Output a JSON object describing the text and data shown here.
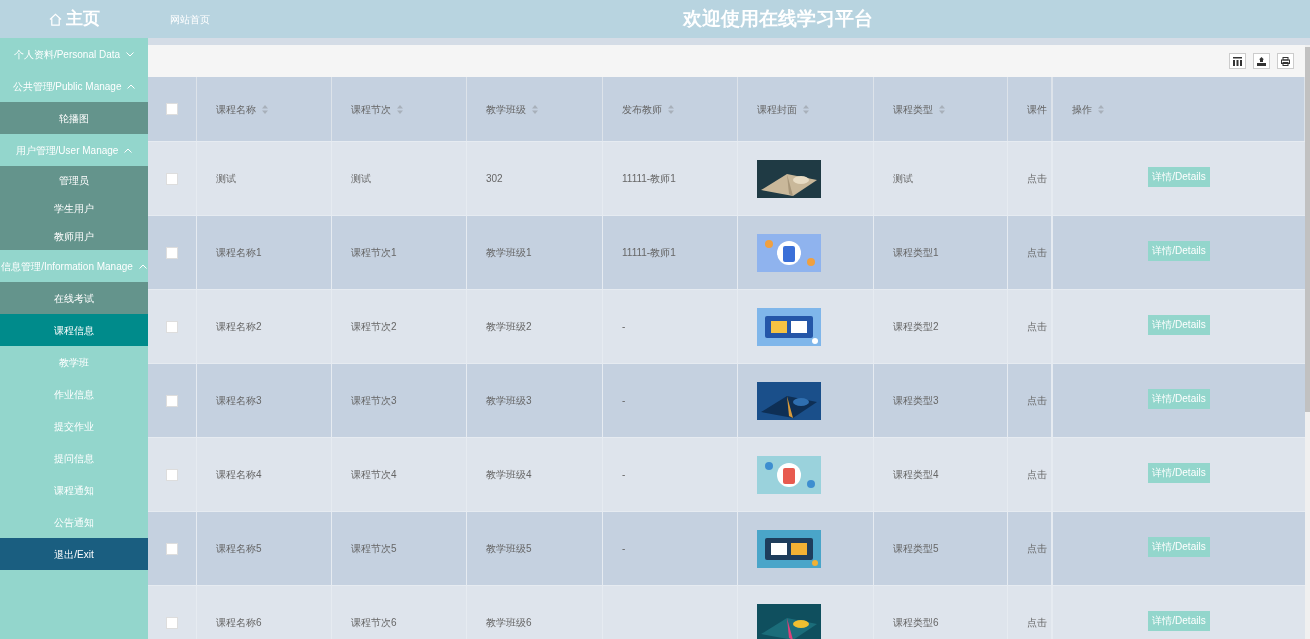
{
  "header": {
    "brand": "主页",
    "home_link": "网站首页",
    "title": "欢迎使用在线学习平台"
  },
  "sidebar": [
    {
      "label": "个人资料/Personal Data",
      "expanded": false
    },
    {
      "label": "公共管理/Public Manage",
      "expanded": true,
      "children": [
        {
          "label": "轮播图",
          "selected": false,
          "shaded": true
        }
      ]
    },
    {
      "label": "用户管理/User Manage",
      "expanded": true,
      "children": [
        {
          "label": "管理员",
          "selected": false,
          "shaded": true
        },
        {
          "label": "学生用户",
          "selected": false,
          "shaded": true
        },
        {
          "label": "教师用户",
          "selected": false,
          "shaded": true
        }
      ]
    },
    {
      "label": "信息管理/Information Manage",
      "expanded": true,
      "children": [
        {
          "label": "在线考试",
          "selected": false,
          "shaded": true
        },
        {
          "label": "课程信息",
          "selected": true,
          "shaded": true
        },
        {
          "label": "教学班",
          "selected": false,
          "shaded": false
        },
        {
          "label": "作业信息",
          "selected": false,
          "shaded": false
        },
        {
          "label": "提交作业",
          "selected": false,
          "shaded": false
        },
        {
          "label": "提问信息",
          "selected": false,
          "shaded": false
        },
        {
          "label": "课程通知",
          "selected": false,
          "shaded": false
        },
        {
          "label": "公告通知",
          "selected": false,
          "shaded": false
        }
      ]
    }
  ],
  "exit": "退出/Exit",
  "table": {
    "all_checked": false,
    "columns": [
      {
        "label": "课程名称",
        "sortable": true
      },
      {
        "label": "课程节次",
        "sortable": true
      },
      {
        "label": "教学班级",
        "sortable": true
      },
      {
        "label": "发布教师",
        "sortable": true
      },
      {
        "label": "课程封面",
        "sortable": true
      },
      {
        "label": "课程类型",
        "sortable": true
      },
      {
        "label": "课件",
        "sortable": false
      },
      {
        "label": "操作",
        "sortable": true
      }
    ],
    "rows": [
      {
        "checked": false,
        "name": "测试",
        "section": "测试",
        "class": "302",
        "teacher": "11111-教师1",
        "type": "测试",
        "courseware": "点击",
        "action": "详情/Details"
      },
      {
        "checked": false,
        "name": "课程名称1",
        "section": "课程节次1",
        "class": "教学班级1",
        "teacher": "11111-教师1",
        "type": "课程类型1",
        "courseware": "点击",
        "action": "详情/Details"
      },
      {
        "checked": false,
        "name": "课程名称2",
        "section": "课程节次2",
        "class": "教学班级2",
        "teacher": "-",
        "type": "课程类型2",
        "courseware": "点击",
        "action": "详情/Details"
      },
      {
        "checked": false,
        "name": "课程名称3",
        "section": "课程节次3",
        "class": "教学班级3",
        "teacher": "-",
        "type": "课程类型3",
        "courseware": "点击",
        "action": "详情/Details"
      },
      {
        "checked": false,
        "name": "课程名称4",
        "section": "课程节次4",
        "class": "教学班级4",
        "teacher": "-",
        "type": "课程类型4",
        "courseware": "点击",
        "action": "详情/Details"
      },
      {
        "checked": false,
        "name": "课程名称5",
        "section": "课程节次5",
        "class": "教学班级5",
        "teacher": "-",
        "type": "课程类型5",
        "courseware": "点击",
        "action": "详情/Details"
      },
      {
        "checked": false,
        "name": "课程名称6",
        "section": "课程节次6",
        "class": "教学班级6",
        "type": "课程类型6",
        "courseware": "点击",
        "action": "详情/Details"
      }
    ]
  }
}
